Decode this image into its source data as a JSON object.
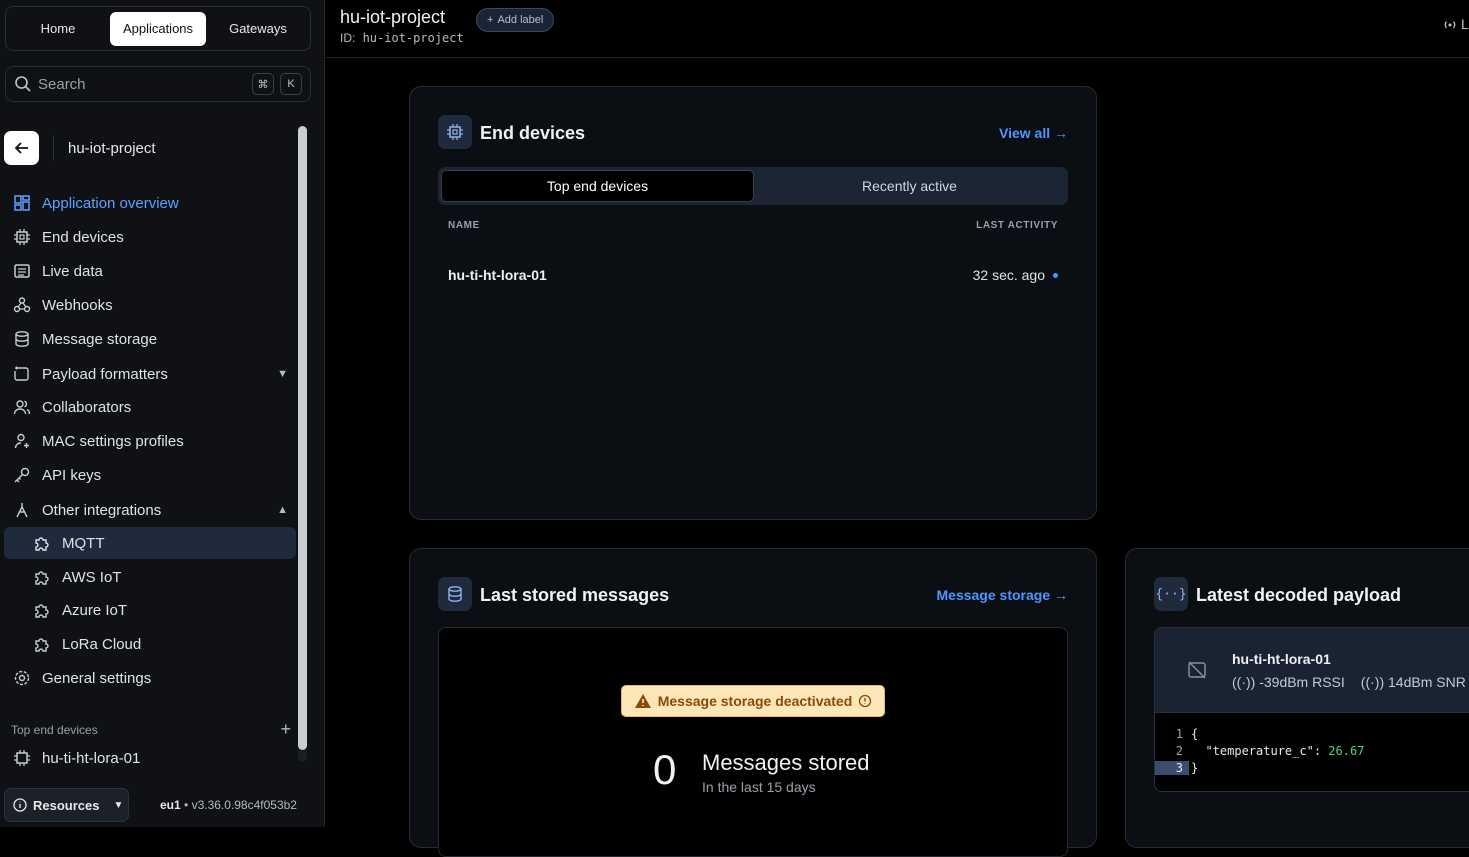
{
  "nav_tabs": [
    "Home",
    "Applications",
    "Gateways"
  ],
  "search": {
    "placeholder": "Search",
    "key1": "⌘",
    "key2": "K"
  },
  "app": {
    "name": "hu-iot-project"
  },
  "sidebar": {
    "items": [
      {
        "label": "Application overview",
        "icon": "overview-icon"
      },
      {
        "label": "End devices",
        "icon": "chip-icon"
      },
      {
        "label": "Live data",
        "icon": "list-icon"
      },
      {
        "label": "Webhooks",
        "icon": "webhook-icon"
      },
      {
        "label": "Message storage",
        "icon": "database-icon"
      },
      {
        "label": "Payload formatters",
        "icon": "code-icon"
      },
      {
        "label": "Collaborators",
        "icon": "users-icon"
      },
      {
        "label": "MAC settings profiles",
        "icon": "user-settings-icon"
      },
      {
        "label": "API keys",
        "icon": "key-icon"
      },
      {
        "label": "Other integrations",
        "icon": "integration-icon"
      },
      {
        "label": "MQTT",
        "icon": "puzzle-icon"
      },
      {
        "label": "AWS IoT",
        "icon": "puzzle-icon"
      },
      {
        "label": "Azure IoT",
        "icon": "puzzle-icon"
      },
      {
        "label": "LoRa Cloud",
        "icon": "puzzle-icon"
      },
      {
        "label": "General settings",
        "icon": "gear-icon"
      }
    ],
    "section_title": "Top end devices",
    "section_item": "hu-ti-ht-lora-01"
  },
  "bottom": {
    "resources": "Resources",
    "cluster": "eu1",
    "version": "v3.36.0.98c4f053b2"
  },
  "header": {
    "title": "hu-iot-project",
    "add_label": "Add label",
    "id_prefix": "ID:",
    "id": "hu-iot-project",
    "live": "L"
  },
  "end_devices": {
    "title": "End devices",
    "view_all": "View all →",
    "tabs": [
      "Top end devices",
      "Recently active"
    ],
    "col_name": "NAME",
    "col_activity": "LAST ACTIVITY",
    "rows": [
      {
        "name": "hu-ti-ht-lora-01",
        "activity": "32 sec. ago"
      }
    ]
  },
  "stored": {
    "title": "Last stored messages",
    "link": "Message storage →",
    "warning": "Message storage deactivated",
    "count": "0",
    "label": "Messages stored",
    "sub": "In the last 15 days"
  },
  "payload": {
    "title": "Latest decoded payload",
    "device": "hu-ti-ht-lora-01",
    "rssi": "-39dBm RSSI",
    "snr": "14dBm SNR",
    "lines": [
      "{",
      "  \"temperature_c\": ",
      "}"
    ],
    "value": "26.67"
  },
  "colors": {
    "accent": "#4d96ff",
    "warn_bg": "#fde7b8",
    "value_green": "#4fd07a"
  }
}
